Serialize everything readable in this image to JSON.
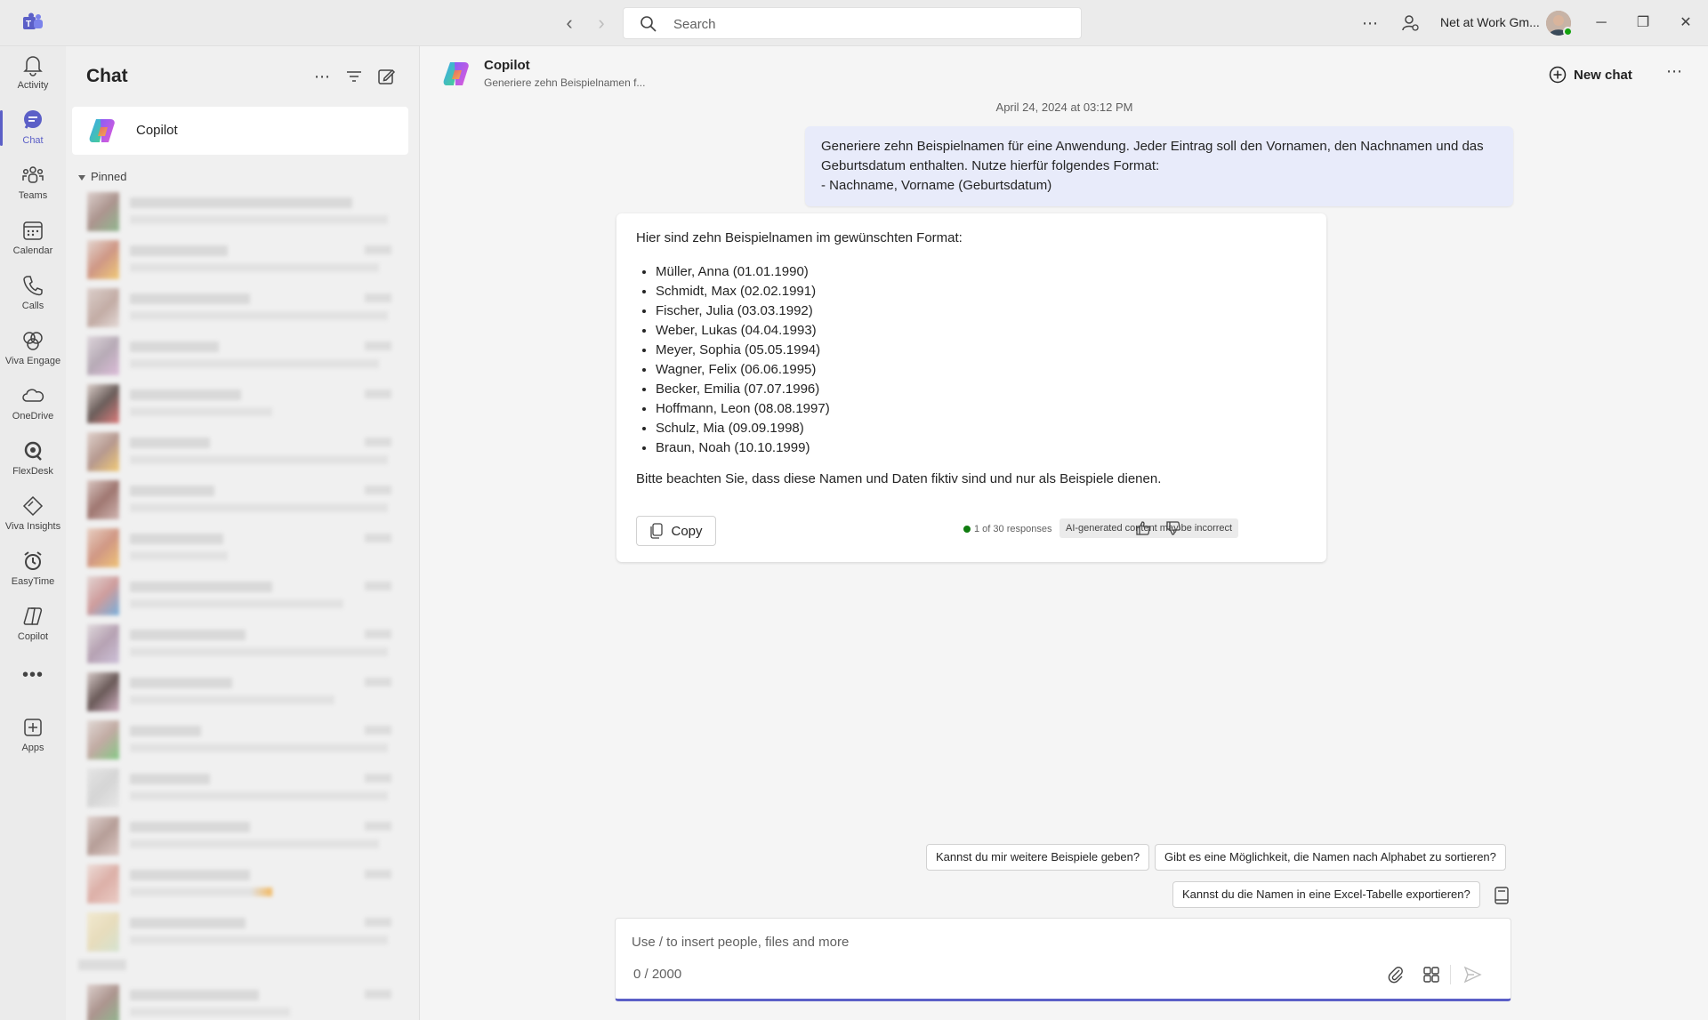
{
  "titlebar": {
    "search_placeholder": "Search",
    "org_name": "Net at Work Gm..."
  },
  "rail": {
    "items": [
      {
        "label": "Activity",
        "icon": "bell-icon"
      },
      {
        "label": "Chat",
        "icon": "chat-icon",
        "active": true
      },
      {
        "label": "Teams",
        "icon": "teams-icon"
      },
      {
        "label": "Calendar",
        "icon": "calendar-icon"
      },
      {
        "label": "Calls",
        "icon": "phone-icon"
      },
      {
        "label": "Viva Engage",
        "icon": "viva-engage-icon"
      },
      {
        "label": "OneDrive",
        "icon": "cloud-icon"
      },
      {
        "label": "FlexDesk",
        "icon": "flexdesk-icon"
      },
      {
        "label": "Viva Insights",
        "icon": "viva-insights-icon"
      },
      {
        "label": "EasyTime",
        "icon": "easytime-icon"
      },
      {
        "label": "Copilot",
        "icon": "copilot-icon"
      },
      {
        "label": "",
        "icon": "more-apps-icon"
      },
      {
        "label": "Apps",
        "icon": "add-app-icon"
      }
    ]
  },
  "chatlist": {
    "title": "Chat",
    "copilot_name": "Copilot",
    "pinned_label": "Pinned"
  },
  "conversation": {
    "title": "Copilot",
    "subtitle": "Generiere zehn Beispielnamen f...",
    "new_chat_label": "New chat",
    "timestamp": "April 24, 2024 at 03:12 PM",
    "user_message": "Generiere zehn Beispielnamen für eine Anwendung. Jeder Eintrag soll den Vornamen, den Nachnamen und das Geburtsdatum enthalten. Nutze hierfür folgendes Format:\n- Nachname, Vorname (Geburtsdatum)",
    "bot_intro": "Hier sind zehn Beispielnamen im gewünschten Format:",
    "bot_list": [
      "Müller, Anna (01.01.1990)",
      "Schmidt, Max (02.02.1991)",
      "Fischer, Julia (03.03.1992)",
      "Weber, Lukas (04.04.1993)",
      "Meyer, Sophia (05.05.1994)",
      "Wagner, Felix (06.06.1995)",
      "Becker, Emilia (07.07.1996)",
      "Hoffmann, Leon (08.08.1997)",
      "Schulz, Mia (09.09.1998)",
      "Braun, Noah (10.10.1999)"
    ],
    "bot_outro": "Bitte beachten Sie, dass diese Namen und Daten fiktiv sind und nur als Beispiele dienen.",
    "copy_label": "Copy",
    "response_count": "1 of 30 responses",
    "ai_disclaimer": "AI-generated content may be incorrect"
  },
  "suggestions": [
    "Kannst du mir weitere Beispiele geben?",
    "Gibt es eine Möglichkeit, die Namen nach Alphabet zu sortieren?",
    "Kannst du die Namen in eine Excel-Tabelle exportieren?"
  ],
  "composer": {
    "placeholder": "Use / to insert people, files and more",
    "counter": "0 / 2000"
  },
  "colors": {
    "accent": "#5b5fc7",
    "user_bubble": "#e8ebfa",
    "presence_available": "#13a10e"
  }
}
